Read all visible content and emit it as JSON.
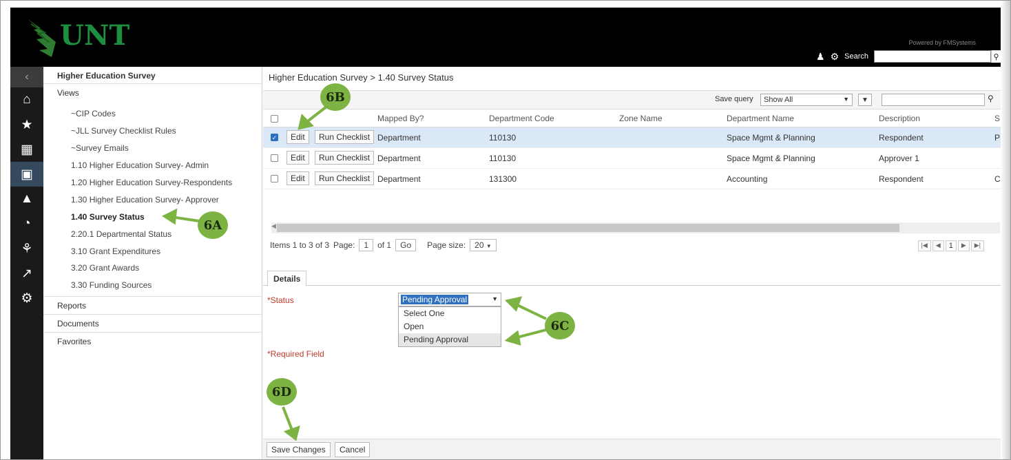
{
  "header": {
    "logo_text": "UNT",
    "powered_by": "Powered by FMSystems",
    "search_label": "Search",
    "search_value": ""
  },
  "rail": {
    "icons": [
      "chevron-left-icon",
      "home-icon",
      "star-icon",
      "floorplan-icon",
      "building-icon",
      "house-icon",
      "pie-chart-icon",
      "chair-icon",
      "line-chart-icon",
      "gears-icon"
    ]
  },
  "nav": {
    "title": "Higher Education Survey",
    "views_label": "Views",
    "items": [
      "~CIP Codes",
      "~JLL Survey Checklist Rules",
      "~Survey Emails",
      "1.10 Higher Education Survey- Admin",
      "1.20 Higher Education Survey-Respondents",
      "1.30 Higher Education Survey- Approver",
      "1.40 Survey Status",
      "2.20.1 Departmental Status",
      "3.10 Grant Expenditures",
      "3.20 Grant Awards",
      "3.30 Funding Sources"
    ],
    "reports": "Reports",
    "documents": "Documents",
    "favorites": "Favorites"
  },
  "main": {
    "breadcrumb": "Higher Education Survey  > 1.40 Survey Status",
    "save_query_label": "Save query",
    "save_query_value": "Show All",
    "grid_search_value": "",
    "columns": [
      "Mapped By?",
      "Department Code",
      "Zone Name",
      "Department Name",
      "Description",
      "S"
    ],
    "rows": [
      {
        "edit": "Edit",
        "run": "Run Checklist",
        "mapped": "Department",
        "code": "110130",
        "zone": "",
        "dept": "Space Mgmt & Planning",
        "desc": "Respondent",
        "s": "P",
        "selected": true
      },
      {
        "edit": "Edit",
        "run": "Run Checklist",
        "mapped": "Department",
        "code": "110130",
        "zone": "",
        "dept": "Space Mgmt & Planning",
        "desc": "Approver 1",
        "s": "",
        "selected": false
      },
      {
        "edit": "Edit",
        "run": "Run Checklist",
        "mapped": "Department",
        "code": "131300",
        "zone": "",
        "dept": "Accounting",
        "desc": "Respondent",
        "s": "C",
        "selected": false
      }
    ],
    "pager": {
      "items_text": "Items 1 to 3 of 3",
      "page_label": "Page:",
      "page_value": "1",
      "of_text": "of 1",
      "go": "Go",
      "page_size_label": "Page size:",
      "page_size_value": "20",
      "current": "1"
    },
    "details_tab": "Details",
    "status_label": "Status",
    "status_value": "Pending Approval",
    "status_options": [
      "Select One",
      "Open",
      "Pending Approval"
    ],
    "required_note": "Required Field",
    "save_button": "Save Changes",
    "cancel_button": "Cancel"
  },
  "annotations": {
    "a": "6A",
    "b": "6B",
    "c": "6C",
    "d": "6D",
    "color": "#7cb342"
  }
}
